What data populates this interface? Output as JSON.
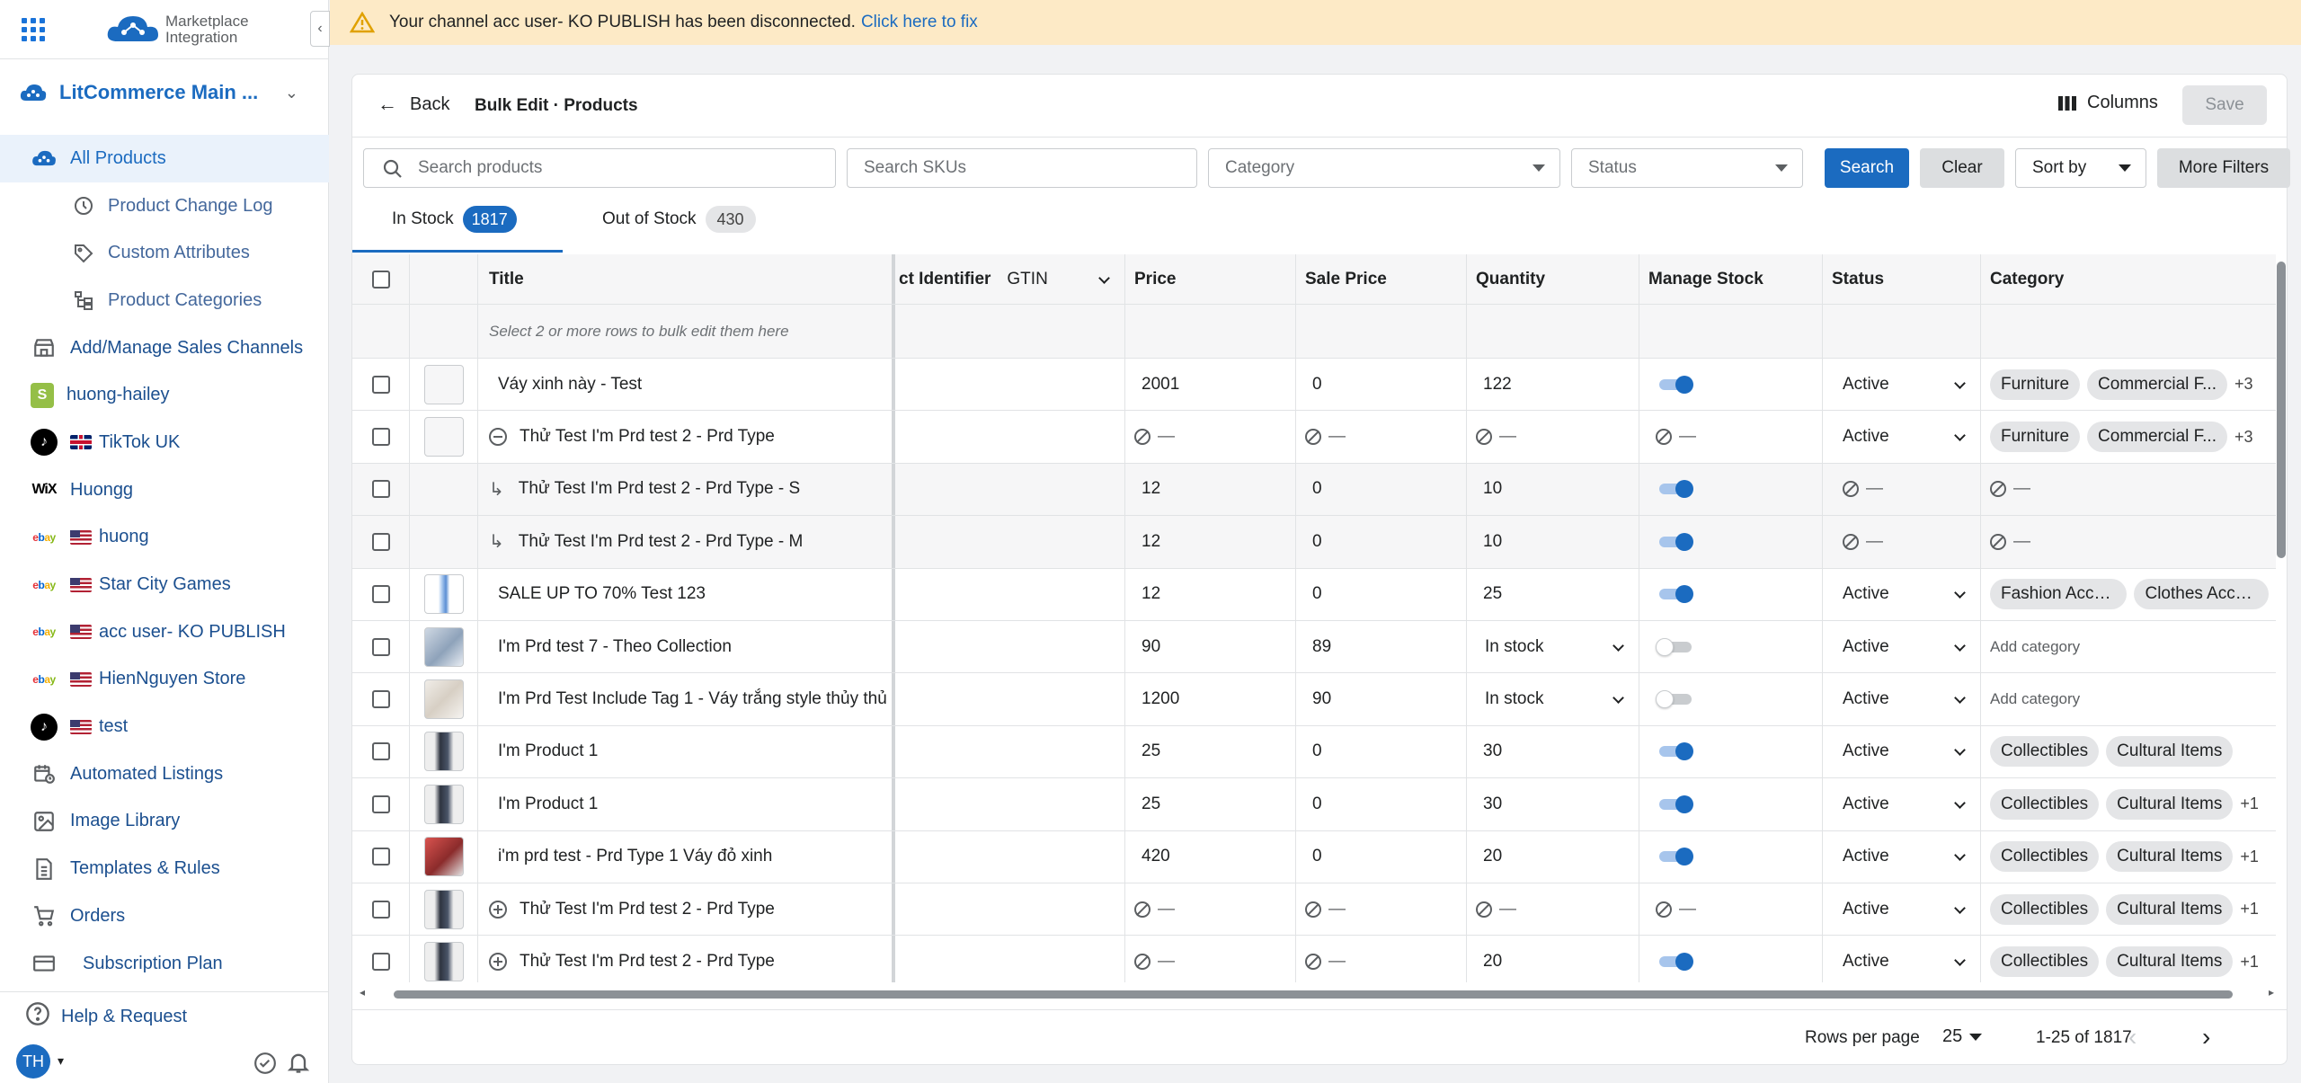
{
  "brand": {
    "line1": "Marketplace",
    "line2": "Integration"
  },
  "store": {
    "name": "LitCommerce Main ..."
  },
  "nav": {
    "all_products": "All Products",
    "product_change_log": "Product Change Log",
    "custom_attributes": "Custom Attributes",
    "product_categories": "Product Categories",
    "add_manage_channels": "Add/Manage Sales Channels",
    "channels": [
      {
        "label": "huong-hailey",
        "type": "shopify"
      },
      {
        "label": "TikTok UK",
        "type": "tiktok",
        "flag": "uk"
      },
      {
        "label": "Huongg",
        "type": "wix"
      },
      {
        "label": "huong",
        "type": "ebay",
        "flag": "us"
      },
      {
        "label": "Star City Games",
        "type": "ebay",
        "flag": "us"
      },
      {
        "label": "acc user- KO PUBLISH",
        "type": "ebay",
        "flag": "us"
      },
      {
        "label": "HienNguyen Store",
        "type": "ebay",
        "flag": "us"
      },
      {
        "label": "test",
        "type": "tiktok",
        "flag": "us"
      }
    ],
    "automated_listings": "Automated Listings",
    "image_library": "Image Library",
    "templates_rules": "Templates & Rules",
    "orders": "Orders",
    "subscription_plan": "Subscription Plan",
    "help": "Help & Request"
  },
  "user": {
    "initials": "TH"
  },
  "banner": {
    "message": "Your channel acc user- KO PUBLISH has been disconnected.",
    "link": "Click here to fix"
  },
  "header": {
    "back": "Back",
    "title": "Bulk Edit · Products",
    "columns": "Columns",
    "save": "Save"
  },
  "filters": {
    "search_products": "Search products",
    "search_skus": "Search SKUs",
    "category": "Category",
    "status": "Status",
    "search_btn": "Search",
    "clear_btn": "Clear",
    "sort_by": "Sort by",
    "more_filters": "More Filters"
  },
  "tabs": [
    {
      "label": "In Stock",
      "count": "1817"
    },
    {
      "label": "Out of Stock",
      "count": "430"
    }
  ],
  "table": {
    "columns": {
      "title": "Title",
      "identifier": "ct Identifier",
      "identifier_value": "GTIN",
      "price": "Price",
      "sale_price": "Sale Price",
      "quantity": "Quantity",
      "manage_stock": "Manage Stock",
      "status": "Status",
      "category": "Category"
    },
    "hint": "Select 2 or more rows to bulk edit them here",
    "na": "—",
    "rows": [
      {
        "title": "Váy xinh này - Test",
        "price": "2001",
        "sale": "0",
        "qty": "122",
        "stock": "on",
        "status": "Active",
        "cats": [
          "Furniture",
          "Commercial F..."
        ],
        "more": "+3"
      },
      {
        "title": "Thử Test I'm Prd test 2 - Prd Type",
        "price": "—",
        "sale": "—",
        "qty": "—",
        "stock": "—",
        "status": "Active",
        "cats": [
          "Furniture",
          "Commercial F..."
        ],
        "more": "+3"
      },
      {
        "title": "Thử Test I'm Prd test 2 - Prd Type - S",
        "price": "12",
        "sale": "0",
        "qty": "10",
        "stock": "on",
        "status": "—",
        "cats": [],
        "more": ""
      },
      {
        "title": "Thử Test I'm Prd test 2 - Prd Type - M",
        "price": "12",
        "sale": "0",
        "qty": "10",
        "stock": "on",
        "status": "—",
        "cats": [],
        "more": ""
      },
      {
        "title": "SALE UP TO 70% Test 123",
        "price": "12",
        "sale": "0",
        "qty": "25",
        "stock": "on",
        "status": "Active",
        "cats": [
          "Fashion Acces...",
          "Clothes Acces..."
        ],
        "more": ""
      },
      {
        "title": "I'm Prd test 7 - Theo Collection",
        "price": "90",
        "sale": "89",
        "qty": "In stock",
        "stock": "off",
        "status": "Active",
        "cats": [],
        "more": "",
        "addcat": "Add category"
      },
      {
        "title": "I'm Prd Test Include Tag 1 - Váy trắng style thủy thủ",
        "price": "1200",
        "sale": "90",
        "qty": "In stock",
        "stock": "off",
        "status": "Active",
        "cats": [],
        "more": "",
        "addcat": "Add category"
      },
      {
        "title": "I'm Product 1",
        "price": "25",
        "sale": "0",
        "qty": "30",
        "stock": "on",
        "status": "Active",
        "cats": [
          "Collectibles",
          "Cultural Items"
        ],
        "more": ""
      },
      {
        "title": "I'm Product 1",
        "price": "25",
        "sale": "0",
        "qty": "30",
        "stock": "on",
        "status": "Active",
        "cats": [
          "Collectibles",
          "Cultural Items"
        ],
        "more": "+1"
      },
      {
        "title": "i'm prd test - Prd Type 1 Váy đỏ xinh",
        "price": "420",
        "sale": "0",
        "qty": "20",
        "stock": "on",
        "status": "Active",
        "cats": [
          "Collectibles",
          "Cultural Items"
        ],
        "more": "+1"
      },
      {
        "title": "Thử Test I'm Prd test 2 - Prd Type",
        "price": "—",
        "sale": "—",
        "qty": "—",
        "stock": "—",
        "status": "Active",
        "cats": [
          "Collectibles",
          "Cultural Items"
        ],
        "more": "+1"
      },
      {
        "title": "Thử Test I'm Prd test 2 - Prd Type",
        "price": "—",
        "sale": "—",
        "qty": "20",
        "stock": "on",
        "status": "Active",
        "cats": [
          "Collectibles",
          "Cultural Items"
        ],
        "more": "+1"
      }
    ]
  },
  "pagination": {
    "rows_per_page_label": "Rows per page",
    "rows_per_page": "25",
    "range": "1-25 of 1817"
  },
  "colors": {
    "accent": "#1b6bc0",
    "banner_bg": "#fdeac6",
    "warning": "#e0a100"
  }
}
